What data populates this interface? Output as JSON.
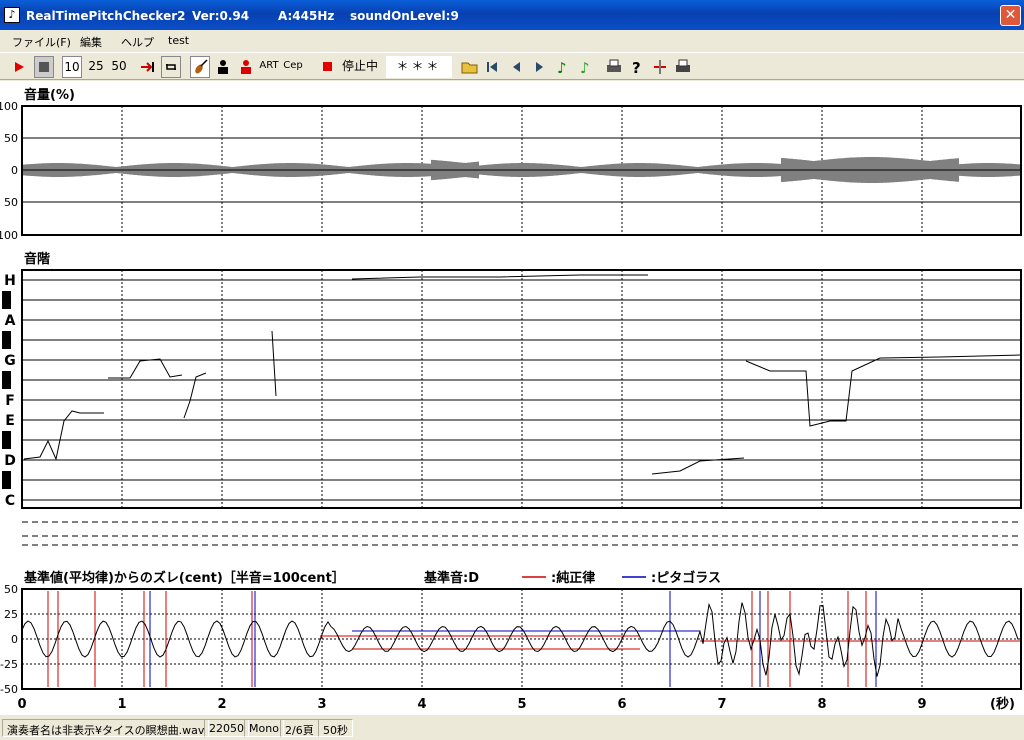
{
  "title": {
    "app": "RealTimePitchChecker2",
    "version": "Ver:0.94",
    "freq": "A:445Hz",
    "sound_level": "soundOnLevel:9",
    "close": "✕"
  },
  "menu": [
    "ファイル(F)",
    "編集",
    "ヘルプ",
    "test"
  ],
  "toolbar": {
    "sizes": [
      "10",
      "25",
      "50"
    ],
    "art": "ART",
    "cep": "Cep",
    "status": "停止中",
    "display": "＊＊＊"
  },
  "volume": {
    "title": "音量(%)",
    "ticks": [
      "100",
      "50",
      "0",
      "50",
      "100"
    ]
  },
  "scale": {
    "title": "音階",
    "notes": [
      "H",
      "A",
      "G",
      "F",
      "E",
      "D",
      "C"
    ]
  },
  "deviation": {
    "title": "基準値(平均律)からのズレ(cent)［半音=100cent］",
    "base": "基準音:D",
    "legend": [
      {
        "name": ":純正律",
        "color": "#d00000"
      },
      {
        "name": ":ピタゴラス",
        "color": "#0000c0"
      }
    ],
    "ticks": [
      "50",
      "25",
      "0",
      "-25",
      "-50"
    ]
  },
  "time_axis": {
    "ticks": [
      "0",
      "1",
      "2",
      "3",
      "4",
      "5",
      "6",
      "7",
      "8",
      "9"
    ],
    "unit": "(秒)"
  },
  "status_bar": {
    "file": "演奏者名は非表示¥タイスの瞑想曲.wav",
    "rate": "22050",
    "channels": "Mono",
    "page": "2/6頁",
    "duration": "50秒"
  },
  "colors": {
    "pure": "#d00000",
    "pythagorean": "#0000c0"
  }
}
